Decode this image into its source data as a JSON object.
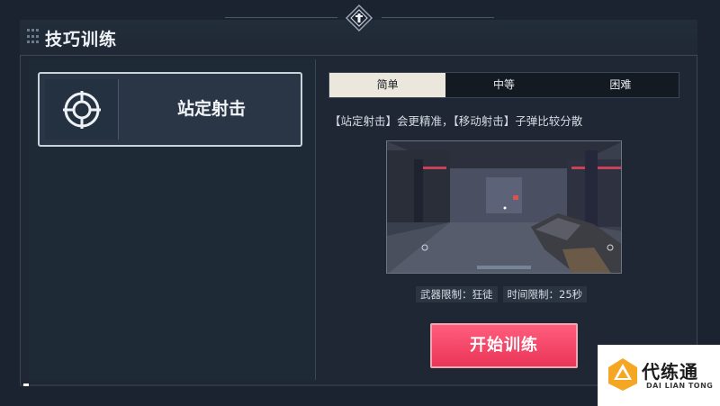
{
  "window": {
    "title": "技巧训练"
  },
  "modes": [
    {
      "label": "站定射击",
      "icon": "crosshair-icon",
      "selected": true
    }
  ],
  "difficulty": {
    "tabs": [
      {
        "label": "简单",
        "active": true
      },
      {
        "label": "中等",
        "active": false
      },
      {
        "label": "困难",
        "active": false
      }
    ]
  },
  "detail": {
    "description": "【站定射击】会更精准，【移动射击】子弹比较分散",
    "weapon_limit": "武器限制：狂徒",
    "time_limit": "时间限制：25秒",
    "start_label": "开始训练"
  },
  "watermark": {
    "main": "代练通",
    "sub": "DAI LIAN TONG"
  },
  "colors": {
    "accent": "#ea3558",
    "background": "#1b2330",
    "active_tab": "#ece7dc"
  }
}
